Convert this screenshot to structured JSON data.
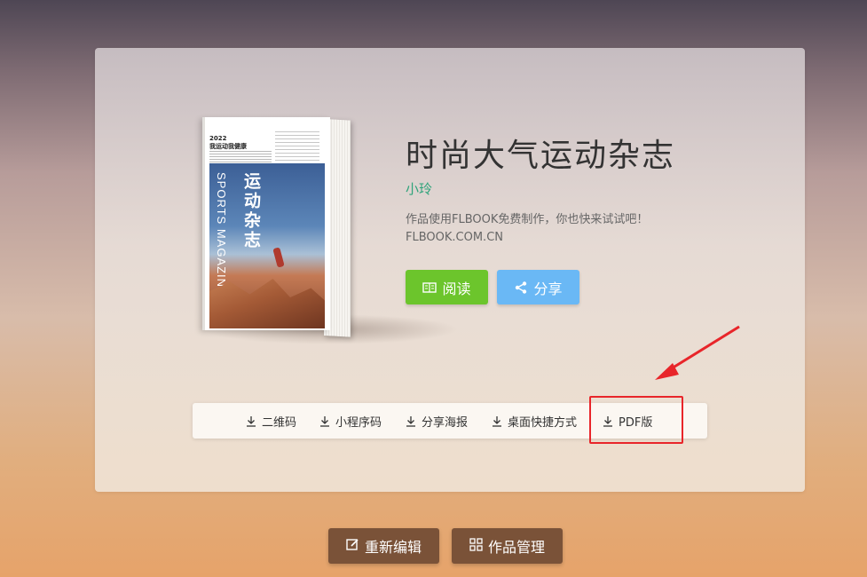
{
  "book": {
    "title": "时尚大气运动杂志",
    "author": "小玲",
    "desc_line1": "作品使用FLBOOK免费制作，你也快来试试吧！",
    "desc_line2": "FLBOOK.COM.CN",
    "cover": {
      "year": "2022",
      "subtitle": "我运动我健康",
      "title_cn": "运动杂志",
      "title_en": "SPORTS MAGAZINE"
    }
  },
  "actions": {
    "read_label": "阅读",
    "share_label": "分享"
  },
  "toolbar": {
    "items": [
      {
        "label": "二维码",
        "icon": "download-icon"
      },
      {
        "label": "小程序码",
        "icon": "download-icon"
      },
      {
        "label": "分享海报",
        "icon": "download-icon"
      },
      {
        "label": "桌面快捷方式",
        "icon": "download-icon"
      },
      {
        "label": "PDF版",
        "icon": "download-icon"
      }
    ]
  },
  "bottom": {
    "edit_label": "重新编辑",
    "manage_label": "作品管理"
  },
  "colors": {
    "read": "#6cc52c",
    "share": "#6ab8f5",
    "author": "#2ea37a",
    "highlight": "#e8252a",
    "bottom_button": "#7a5238"
  }
}
